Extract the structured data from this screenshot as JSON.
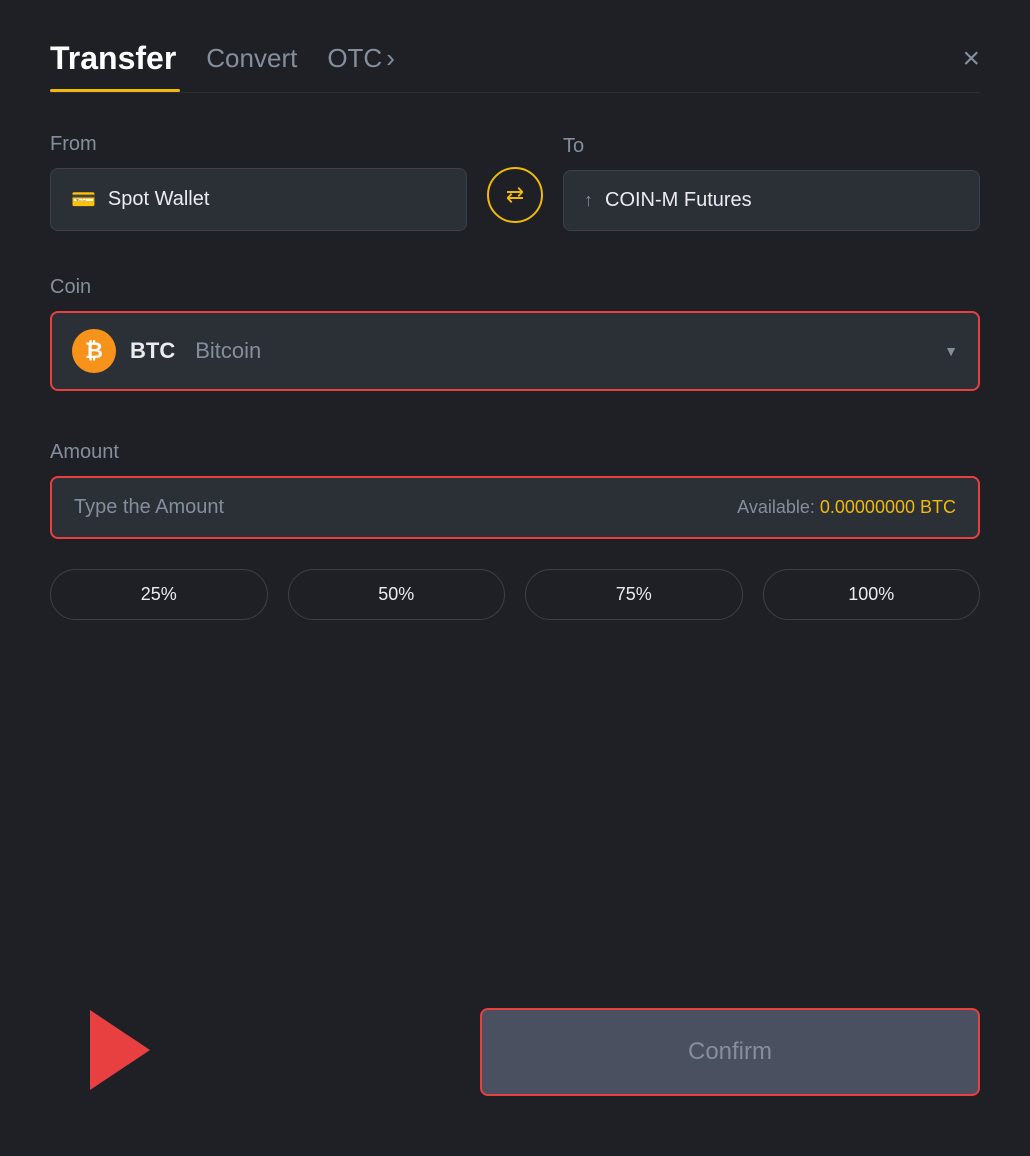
{
  "header": {
    "title": "Transfer",
    "tab_convert": "Convert",
    "tab_otc": "OTC",
    "tab_otc_arrow": "›",
    "close_label": "×"
  },
  "from_section": {
    "label": "From",
    "wallet_name": "Spot Wallet",
    "wallet_icon": "💳"
  },
  "to_section": {
    "label": "To",
    "wallet_name": "COIN-M Futures",
    "wallet_icon": "↑"
  },
  "swap": {
    "icon": "⇄"
  },
  "coin_section": {
    "label": "Coin",
    "coin_symbol": "BTC",
    "coin_name": "Bitcoin"
  },
  "amount_section": {
    "label": "Amount",
    "placeholder": "Type the Amount",
    "available_label": "Available:",
    "available_amount": "0.00000000 BTC"
  },
  "percentage_buttons": [
    {
      "label": "25%",
      "value": "25"
    },
    {
      "label": "50%",
      "value": "50"
    },
    {
      "label": "75%",
      "value": "75"
    },
    {
      "label": "100%",
      "value": "100"
    }
  ],
  "confirm_button": {
    "label": "Confirm"
  },
  "colors": {
    "accent_gold": "#f0b90b",
    "accent_red": "#e84040",
    "bg_dark": "#1e2026",
    "text_muted": "#848e9c"
  }
}
